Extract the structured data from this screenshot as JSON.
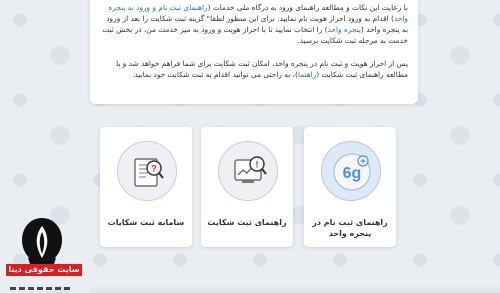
{
  "intro": {
    "line1_pre": "با رعایت این نکات و مطالعه راهنمای ورود به درگاه ملی خدمات (",
    "line1_link": "راهنمای ثبت نام و ورود به پنجره واحد",
    "line1_post": ") اقدام به ورود احراز هویت نام نمایید. برای این منظور لطفا\" گزینه ثبت شکایت را بعد از ورود به پنجره واحد (",
    "line2_link": "پنجره واحد",
    "line2_post": ") را انتخاب نمایید تا با احراز هویت و ورود به میز خدمت من، در بخش ثبت خدمت به مرحله ثبت شکایت برسید.",
    "para2_pre": "پس از احراز هویت و ثبت نام در پنجره واحد، امکان ثبت شکایت برای شما فراهم خواهد شد و با مطالعه راهنمای ثبت شکایت (",
    "para2_link": "راهنما",
    "para2_post": ")، به راحتی می توانید اقدام به ثبت شکایت خود نمایید."
  },
  "tiles": [
    {
      "label": "راهنمای ثبت نام در پنجره واحد",
      "icon": "window-registration-icon",
      "accent": "#4a90d9"
    },
    {
      "label": "راهنمای ثبت شکایت",
      "icon": "complaint-guide-icon",
      "accent": "#555555"
    },
    {
      "label": "سامانه ثبت شکایات",
      "icon": "complaint-system-icon",
      "accent": "#555555"
    }
  ],
  "brand": {
    "name": "سایت حقوقی دینا",
    "color": "#d61f26"
  }
}
